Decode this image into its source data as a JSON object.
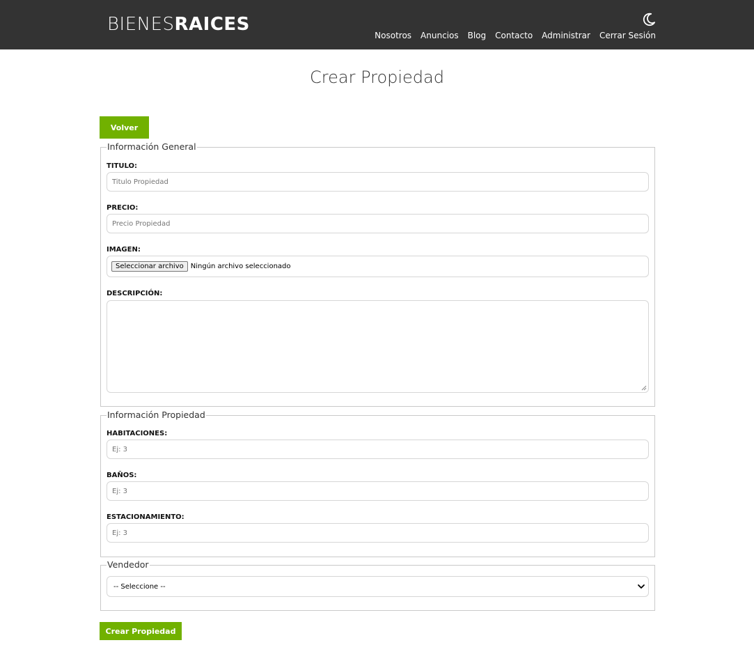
{
  "header": {
    "logo_light": "BIENES",
    "logo_bold": "RAICES",
    "theme_icon": "moon-icon",
    "nav": [
      "Nosotros",
      "Anuncios",
      "Blog",
      "Contacto",
      "Administrar",
      "Cerrar Sesión"
    ]
  },
  "page_title": "Crear Propiedad",
  "back_button": "Volver",
  "general": {
    "legend": "Información General",
    "titulo_label": "TITULO:",
    "titulo_placeholder": "Titulo Propiedad",
    "precio_label": "PRECIO:",
    "precio_placeholder": "Precio Propiedad",
    "imagen_label": "IMAGEN:",
    "file_button": "Seleccionar archivo",
    "file_status": "Ningún archivo seleccionado",
    "descripcion_label": "DESCRIPCIÓN:"
  },
  "propiedad": {
    "legend": "Información Propiedad",
    "habitaciones_label": "HABITACIONES:",
    "habitaciones_placeholder": "Ej: 3",
    "banos_label": "BAÑOS:",
    "banos_placeholder": "Ej: 3",
    "estacionamiento_label": "ESTACIONAMIENTO:",
    "estacionamiento_placeholder": "Ej: 3"
  },
  "vendedor": {
    "legend": "Vendedor",
    "selected": "-- Seleccione --"
  },
  "submit_button": "Crear Propiedad",
  "colors": {
    "header_bg": "#333333",
    "accent_green": "#71b100"
  }
}
